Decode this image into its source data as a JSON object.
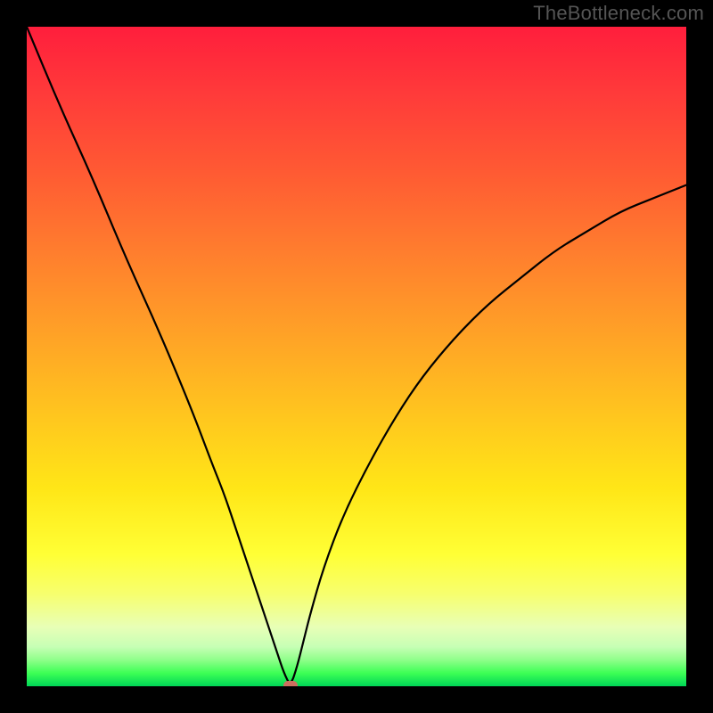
{
  "watermark": "TheBottleneck.com",
  "chart_data": {
    "type": "line",
    "title": "",
    "xlabel": "",
    "ylabel": "",
    "xlim": [
      0,
      100
    ],
    "ylim": [
      0,
      100
    ],
    "grid": false,
    "legend": false,
    "annotations": [],
    "background_gradient": {
      "orientation": "vertical",
      "stops": [
        {
          "pos": 0,
          "color": "#ff1e3c"
        },
        {
          "pos": 10,
          "color": "#ff3a3a"
        },
        {
          "pos": 22,
          "color": "#ff5a33"
        },
        {
          "pos": 34,
          "color": "#ff7d2e"
        },
        {
          "pos": 46,
          "color": "#ffa027"
        },
        {
          "pos": 58,
          "color": "#ffc31f"
        },
        {
          "pos": 70,
          "color": "#ffe617"
        },
        {
          "pos": 80,
          "color": "#ffff35"
        },
        {
          "pos": 86,
          "color": "#f7ff6e"
        },
        {
          "pos": 91,
          "color": "#e8ffb6"
        },
        {
          "pos": 94,
          "color": "#c7ffb5"
        },
        {
          "pos": 96,
          "color": "#8fff8a"
        },
        {
          "pos": 98,
          "color": "#3dff55"
        },
        {
          "pos": 100,
          "color": "#00d656"
        }
      ]
    },
    "marker": {
      "x": 40,
      "y": 0,
      "color": "#cc6f5f",
      "shape": "rounded-rect"
    },
    "series": [
      {
        "name": "curve",
        "color": "#000000",
        "x": [
          0,
          5,
          10,
          15,
          20,
          25,
          28,
          30,
          32,
          34,
          35,
          36,
          37,
          38,
          39,
          40,
          41,
          42,
          43,
          45,
          48,
          52,
          56,
          60,
          65,
          70,
          75,
          80,
          85,
          90,
          95,
          100
        ],
        "y": [
          100,
          88,
          77,
          65,
          54,
          42,
          34,
          29,
          23,
          17,
          14,
          11,
          8,
          5,
          2,
          0,
          3,
          7,
          11,
          18,
          26,
          34,
          41,
          47,
          53,
          58,
          62,
          66,
          69,
          72,
          74,
          76
        ]
      }
    ]
  }
}
